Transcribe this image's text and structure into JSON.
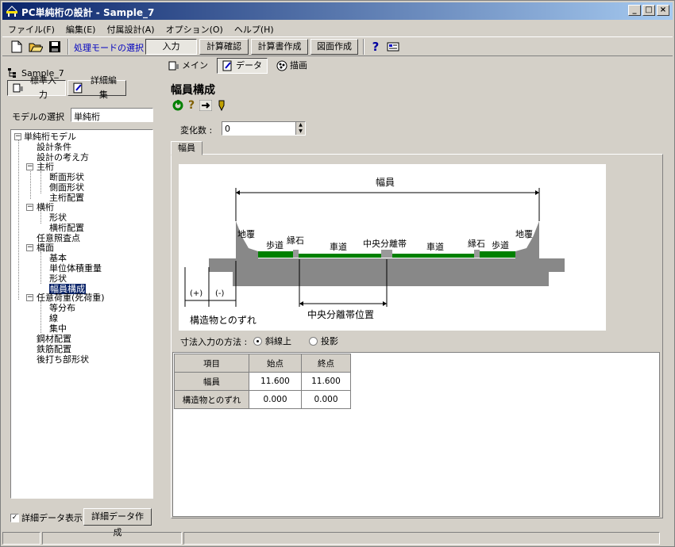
{
  "window": {
    "title": "PC単純桁の設計 - Sample_7"
  },
  "menu": [
    "ファイル(F)",
    "編集(E)",
    "付属設計(A)",
    "オプション(O)",
    "ヘルプ(H)"
  ],
  "toolbar": {
    "mode_label": "処理モードの選択",
    "modes": [
      "入力",
      "計算確認",
      "計算書作成",
      "図面作成"
    ]
  },
  "left": {
    "project": "Sample_7",
    "tabs": [
      "標準入力",
      "詳細編集"
    ],
    "model_label": "モデルの選択",
    "model_value": "単純桁",
    "tree": [
      "単純桁モデル",
      "設計条件",
      "設計の考え方",
      "主桁",
      "断面形状",
      "側面形状",
      "主桁配置",
      "横桁",
      "形状",
      "横桁配置",
      "任意照査点",
      "橋面",
      "基本",
      "単位体積重量",
      "形状",
      "幅員構成",
      "任意荷重(死荷重)",
      "等分布",
      "線",
      "集中",
      "鋼材配置",
      "鉄筋配置",
      "後打ち部形状"
    ],
    "detail_check_label": "詳細データ表示",
    "detail_button": "詳細データ作成"
  },
  "right": {
    "tabs": [
      "メイン",
      "データ",
      "描画"
    ],
    "section_title": "幅員構成",
    "count_label": "変化数 :",
    "count_value": "0",
    "inner_tab": "幅員",
    "diagram": {
      "width_label": "幅員",
      "labels": [
        "地覆",
        "歩道",
        "縁石",
        "車道",
        "中央分離帯",
        "車道",
        "縁石",
        "歩道",
        "地覆"
      ],
      "plus": "(+)",
      "minus": "(-)",
      "offset_label": "構造物とのずれ",
      "median_label": "中央分離帯位置"
    },
    "method_label": "寸法入力の方法 :",
    "method_options": [
      "斜線上",
      "投影"
    ],
    "method_selected": "斜線上",
    "table": {
      "headers": [
        "項目",
        "始点",
        "終点"
      ],
      "rows": [
        [
          "幅員",
          "11.600",
          "11.600"
        ],
        [
          "構造物とのずれ",
          "0.000",
          "0.000"
        ]
      ]
    }
  }
}
